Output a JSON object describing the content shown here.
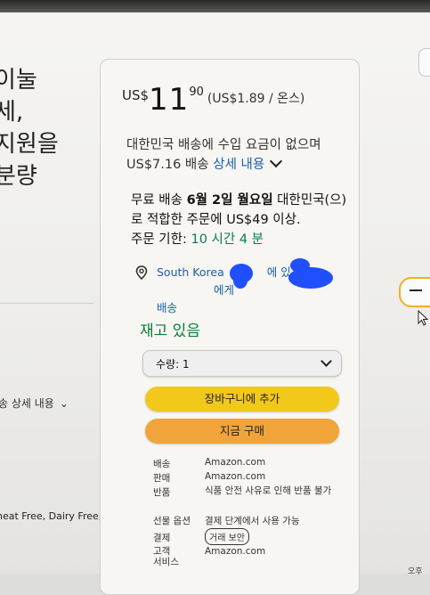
{
  "left": {
    "description_lines": [
      "이눌",
      "세,",
      "지원을",
      "분량"
    ],
    "shipping_details": "송 상세 내용",
    "tags": "heat Free, Dairy Free,"
  },
  "price": {
    "currency": "US$",
    "whole": "11",
    "fraction": "90",
    "unit_price": "(US$1.89 / 온스)"
  },
  "shipping": {
    "line1": "대한민국 배송에 수입 요금이 없으며 US$7.16 배송",
    "details_link": "상세 내용",
    "free_prefix": "무료 배송",
    "free_date": "6월 2일 월요일",
    "free_suffix": "대한민국(으)로 적합한 주문에 US$49 이상.",
    "deadline_label": "주문 기한:",
    "deadline_value": "10 시간 4 분"
  },
  "location": {
    "line1": "South Korea",
    "line1_mid": "에 있는",
    "line1_end": "에게",
    "line2": "배송"
  },
  "stock": "재고 있음",
  "quantity": {
    "label": "수량:",
    "value": "1"
  },
  "buttons": {
    "add_to_cart": "장바구니에 추가",
    "buy_now": "지금 구매"
  },
  "info": [
    {
      "key": "배송",
      "value": "Amazon.com"
    },
    {
      "key": "판매",
      "value": "Amazon.com"
    },
    {
      "key": "반품",
      "value": "식품 안전 사유로 인해 반품 불가"
    },
    {
      "key": "선물 옵션",
      "value": "결제 단계에서 사용 가능"
    },
    {
      "key": "결제",
      "value": "거래 보안"
    },
    {
      "key": "고객 서비스",
      "value": "Amazon.com"
    }
  ],
  "corner": "오후",
  "colors": {
    "cart_button": "#f2c81b",
    "buy_button": "#f0a43a",
    "in_stock": "#0a7a3a",
    "link": "#1a5fa8"
  }
}
